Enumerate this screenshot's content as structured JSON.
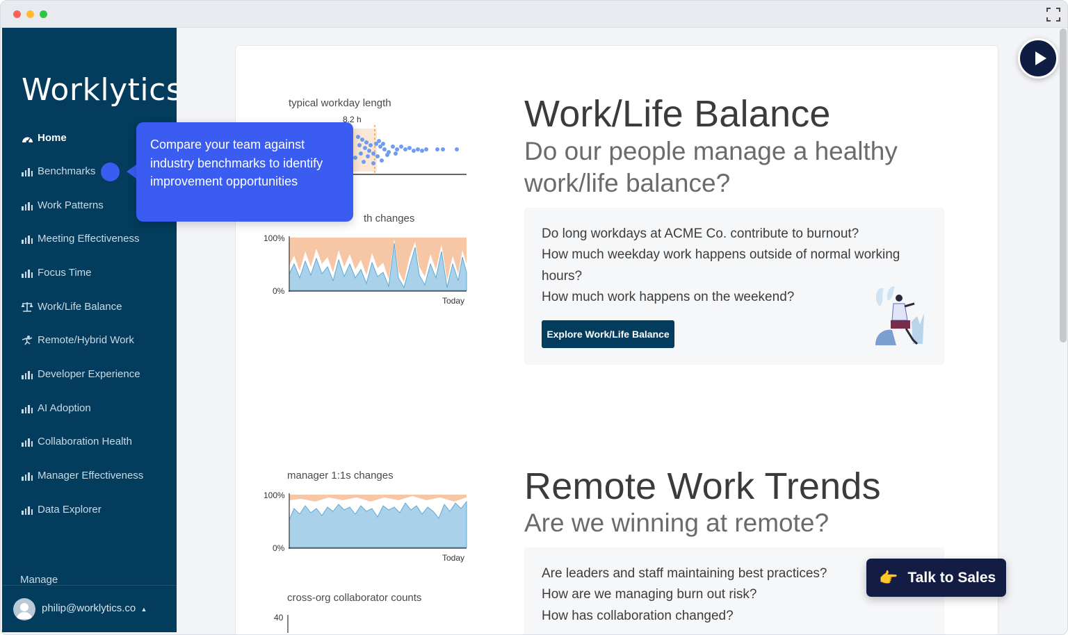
{
  "app": {
    "logo": "Worklytics"
  },
  "sidebar": {
    "items": [
      {
        "label": "Home",
        "icon": "dashboard-icon",
        "active": true
      },
      {
        "label": "Benchmarks",
        "icon": "bar-chart-icon"
      },
      {
        "label": "Work Patterns",
        "icon": "bar-chart-icon"
      },
      {
        "label": "Meeting Effectiveness",
        "icon": "bar-chart-icon"
      },
      {
        "label": "Focus Time",
        "icon": "bar-chart-icon"
      },
      {
        "label": "Work/Life Balance",
        "icon": "scale-icon"
      },
      {
        "label": "Remote/Hybrid Work",
        "icon": "remote-icon"
      },
      {
        "label": "Developer Experience",
        "icon": "bar-chart-icon"
      },
      {
        "label": "AI Adoption",
        "icon": "bar-chart-icon"
      },
      {
        "label": "Collaboration Health",
        "icon": "bar-chart-icon"
      },
      {
        "label": "Manager Effectiveness",
        "icon": "bar-chart-icon"
      },
      {
        "label": "Data Explorer",
        "icon": "bar-chart-icon"
      }
    ],
    "manage_label": "Manage",
    "user_email": "philip@worklytics.co"
  },
  "tooltip": {
    "text": "Compare your team against industry benchmarks to identify improvement opportunities"
  },
  "charts": {
    "workday_length": {
      "label": "typical workday length",
      "marker": "8.2 h"
    },
    "workday_changes": {
      "label_end": "th changes",
      "y_top": "100%",
      "y_bottom": "0%",
      "x_end": "Today"
    },
    "manager_changes": {
      "label": "manager 1:1s changes",
      "y_top": "100%",
      "y_bottom": "0%",
      "x_end": "Today"
    },
    "cross_org": {
      "label": "cross-org collaborator counts",
      "y_top": "40"
    }
  },
  "sections": {
    "worklife": {
      "title": "Work/Life Balance",
      "subtitle": "Do our people manage a healthy work/life balance?",
      "questions": [
        "Do long workdays at ACME Co. contribute to burnout?",
        "How much weekday work happens outside of normal working hours?",
        "How much work happens on the weekend?"
      ],
      "button": "Explore Work/Life Balance"
    },
    "remote": {
      "title": "Remote Work Trends",
      "subtitle": "Are we winning at remote?",
      "questions": [
        "Are leaders and staff maintaining best practices?",
        "How are we managing burn out risk?",
        "How has collaboration changed?"
      ]
    }
  },
  "cta": {
    "talk_to_sales": "Talk to Sales"
  },
  "colors": {
    "sidebar": "#033c5c",
    "accent": "#3a5cf0",
    "cta": "#131c42",
    "chart_blue": "#a9d2ea",
    "chart_orange": "#f7b98e"
  }
}
